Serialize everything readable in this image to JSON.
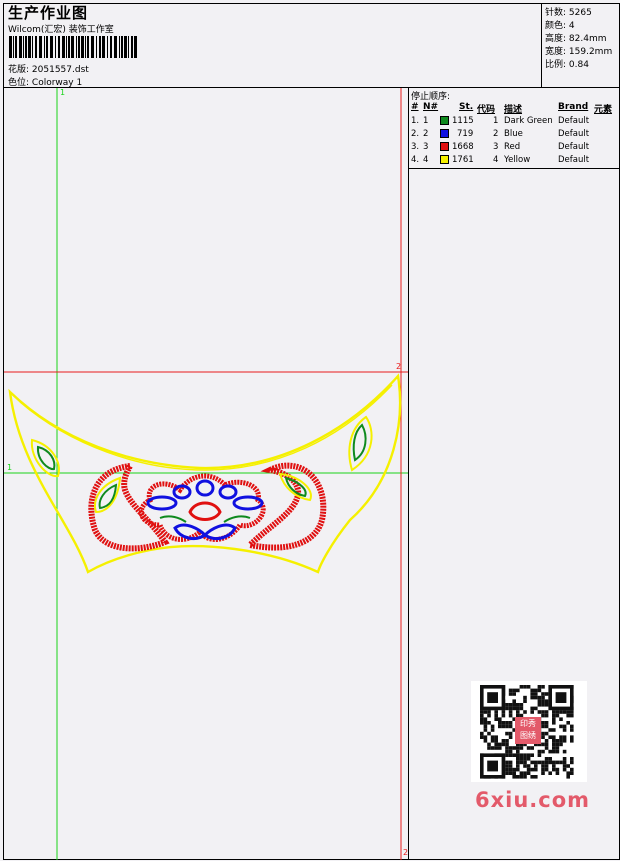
{
  "header": {
    "title": "生产作业图",
    "company": "Wilcom(汇宏) 装饰工作室",
    "design_label": "花版:",
    "design_file": "2051557.dst",
    "colorway_label": "色位:",
    "colorway": "Colorway 1"
  },
  "stats": [
    {
      "label": "针数:",
      "value": "5265"
    },
    {
      "label": "颜色:",
      "value": "4"
    },
    {
      "label": "高度:",
      "value": "82.4mm"
    },
    {
      "label": "宽度:",
      "value": "159.2mm"
    },
    {
      "label": "比例:",
      "value": "0.84"
    }
  ],
  "thread_table": {
    "heading": "停止顺序:",
    "columns": [
      "#",
      "N#",
      "St.",
      "代码",
      "描述",
      "Brand",
      "元素"
    ],
    "rows": [
      {
        "index": "1.",
        "n": "1",
        "color": "#0f8a1e",
        "stitches": "1115",
        "code": "1",
        "desc": "Dark Green",
        "brand": "Default"
      },
      {
        "index": "2.",
        "n": "2",
        "color": "#1010e0",
        "stitches": "719",
        "code": "2",
        "desc": "Blue",
        "brand": "Default"
      },
      {
        "index": "3.",
        "n": "3",
        "color": "#e01010",
        "stitches": "1668",
        "code": "3",
        "desc": "Red",
        "brand": "Default"
      },
      {
        "index": "4.",
        "n": "4",
        "color": "#f5f000",
        "stitches": "1761",
        "code": "4",
        "desc": "Yellow",
        "brand": "Default"
      }
    ]
  },
  "design_area": {
    "guide_markers": {
      "v_green_top": "1",
      "h_green_left": "1",
      "h_red_right": "2",
      "v_red_bottom": "2"
    },
    "guide_colors": {
      "green": "#19d419",
      "red": "#e81b1b"
    }
  },
  "watermark": {
    "text": "6xiu.com",
    "stamp_lines": [
      "印秀",
      "图绣"
    ]
  }
}
